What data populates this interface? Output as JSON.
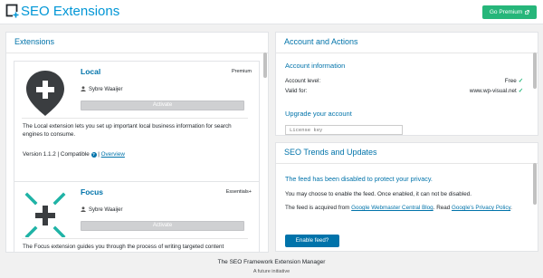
{
  "header": {
    "title": "SEO Extensions",
    "logo_icon": "seo-framework-logo-icon",
    "premium_button": "Go Premium",
    "premium_icon": "external-link-icon",
    "brand_color": "#0096d6",
    "premium_color": "#26b67a"
  },
  "extensions": {
    "title": "Extensions",
    "items": [
      {
        "name": "Local",
        "tier": "Premium",
        "author": "Sybre Waaijer",
        "activate": "Activate",
        "description": "The Local extension lets you set up important local business information for search engines to consume.",
        "version": "Version 1.1.2 | Compatible",
        "overview": "Overview",
        "icon": "map-pin-plus-icon"
      },
      {
        "name": "Focus",
        "tier": "Essentials+",
        "author": "Sybre Waaijer",
        "activate": "Activate",
        "description": "The Focus extension guides you through the process of writing targeted content",
        "icon": "focus-target-plus-icon"
      }
    ]
  },
  "account": {
    "title": "Account and Actions",
    "info_heading": "Account information",
    "level_label": "Account level:",
    "level_value": "Free",
    "valid_label": "Valid for:",
    "valid_value": "www.wp-visual.net",
    "upgrade_heading": "Upgrade your account",
    "license_placeholder": "License key"
  },
  "trends": {
    "title": "SEO Trends and Updates",
    "notice": "The feed has been disabled to protect your privacy.",
    "enable_text": "You may choose to enable the feed. Once enabled, it can not be disabled.",
    "acquired_prefix": "The feed is acquired from",
    "acquired_link": "Google Webmaster Central Blog",
    "acquired_mid": ". Read",
    "privacy_link": "Google's Privacy Policy",
    "privacy_suffix": ".",
    "enable_button": "Enable feed?"
  },
  "footer": {
    "title": "The SEO Framework Extension Manager",
    "subtitle": "A future initiative"
  }
}
